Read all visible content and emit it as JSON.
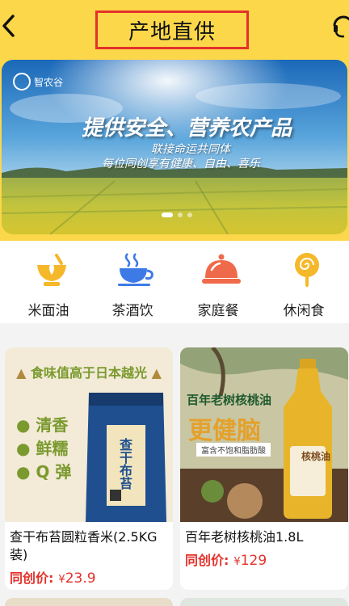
{
  "header": {
    "title": "产地直供",
    "back_icon": "back-chevron-icon",
    "service_icon": "customer-service-icon",
    "background": "#fcd74a",
    "title_box_border": "#e4312b"
  },
  "banner": {
    "logo_text": "智农谷",
    "headline": "提供安全、营养农产品",
    "subline1": "联接命运共同体",
    "subline2": "每位同创享有健康、自由、喜乐",
    "active_slide": 1,
    "slide_count": 3
  },
  "categories": [
    {
      "label": "米面油",
      "icon": "grain-bowl-icon",
      "color": "#f5b82a"
    },
    {
      "label": "茶酒饮",
      "icon": "tea-cup-icon",
      "color": "#3d7ae6"
    },
    {
      "label": "家庭餐",
      "icon": "food-cloche-icon",
      "color": "#ef6a4a"
    },
    {
      "label": "休闲食",
      "icon": "lollipop-icon",
      "color": "#f5b82a"
    }
  ],
  "products": [
    {
      "title": "查干布苔圆粒香米(2.5KG装)",
      "price_label": "同创价:",
      "currency": "¥",
      "price": "23.9",
      "image": {
        "banner_text": "食味值高于日本越光",
        "features": [
          "清香",
          "鲜糯",
          "Q 弹"
        ],
        "bag_text": "查干布苔"
      }
    },
    {
      "title": "百年老树核桃油1.8L",
      "price_label": "同创价:",
      "currency": "¥",
      "price": "129",
      "image": {
        "headline": "百年老树核桃油",
        "slogan": "更健脑",
        "tag": "富含不饱和脂肪酸",
        "bottle_text": "核桃油"
      }
    }
  ],
  "accent_red": "#e4312b"
}
